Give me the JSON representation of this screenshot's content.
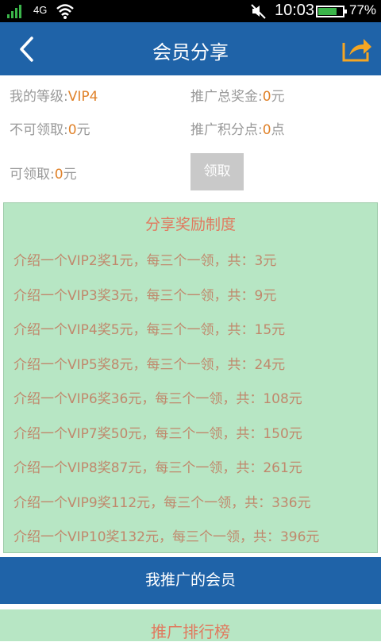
{
  "status_bar": {
    "network": "4G",
    "time": "10:03",
    "battery": "77%",
    "battery_level": 0.77
  },
  "header": {
    "title": "会员分享"
  },
  "info": {
    "level_label": "我的等级:",
    "level_value": "VIP4",
    "bonus_label": "推广总奖金:",
    "bonus_value": "0",
    "bonus_unit": "元",
    "unclaimable_label": "不可领取:",
    "unclaimable_value": "0",
    "unclaimable_unit": "元",
    "points_label": "推广积分点:",
    "points_value": "0",
    "points_unit": "点",
    "claimable_label": "可领取:",
    "claimable_value": "0",
    "claimable_unit": "元",
    "claim_button": "领取"
  },
  "rules": {
    "title": "分享奖励制度",
    "items": [
      "介绍一个VIP2奖1元，每三个一领，共：3元",
      "介绍一个VIP3奖3元，每三个一领，共：9元",
      "介绍一个VIP4奖5元，每三个一领，共：15元",
      "介绍一个VIP5奖8元，每三个一领，共：24元",
      "介绍一个VIP6奖36元，每三个一领，共：108元",
      "介绍一个VIP7奖50元，每三个一领，共：150元",
      "介绍一个VIP8奖87元，每三个一领，共：261元",
      "介绍一个VIP9奖112元，每三个一领，共：336元",
      "介绍一个VIP10奖132元，每三个一领，共：396元"
    ]
  },
  "my_members_button": "我推广的会员",
  "ranking": {
    "title": "推广排行榜"
  },
  "colors": {
    "header": "#1f63a8",
    "accent": "#e0822a",
    "rules_bg": "#b7e6c4",
    "rules_title": "#e07a5f",
    "rules_text": "#c0886c"
  }
}
